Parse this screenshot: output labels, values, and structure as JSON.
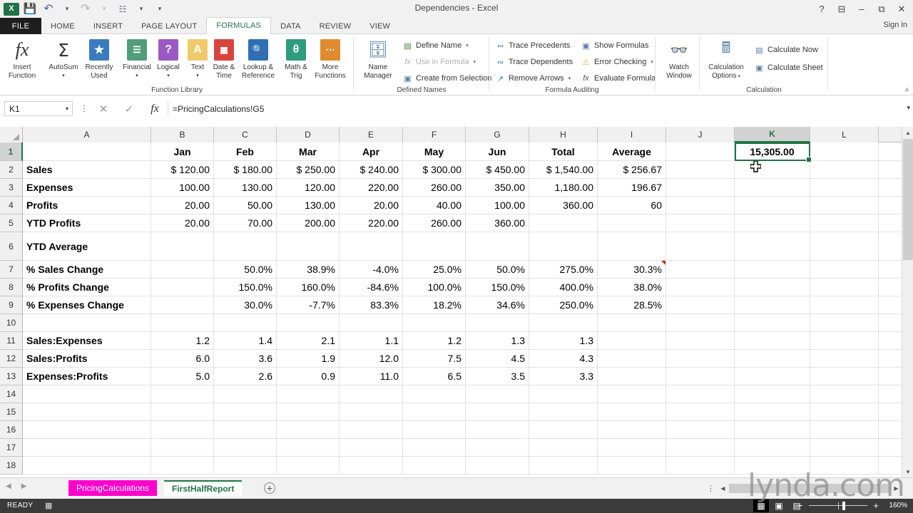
{
  "window": {
    "title": "Dependencies - Excel",
    "signin": "Sign in",
    "help_icon": "?",
    "ribbon_display_icon": "ribbon-display-options",
    "minimize_icon": "minimize",
    "restore_icon": "restore",
    "close_icon": "close"
  },
  "qat": {
    "app_icon": "excel-logo",
    "save_icon": "save",
    "undo_icon": "undo",
    "redo_icon": "redo",
    "touch_icon": "touch-mode",
    "more_icon": "customize-quick-access"
  },
  "tabs": {
    "file": "FILE",
    "items": [
      {
        "label": "HOME",
        "active": false
      },
      {
        "label": "INSERT",
        "active": false
      },
      {
        "label": "PAGE LAYOUT",
        "active": false
      },
      {
        "label": "FORMULAS",
        "active": true
      },
      {
        "label": "DATA",
        "active": false
      },
      {
        "label": "REVIEW",
        "active": false
      },
      {
        "label": "VIEW",
        "active": false
      }
    ]
  },
  "ribbon": {
    "collapse_icon": "collapse-ribbon",
    "groups": [
      {
        "label": "Function Library"
      },
      {
        "label": "Defined Names"
      },
      {
        "label": "Formula Auditing"
      },
      {
        "label": "Calculation"
      }
    ],
    "function_library": {
      "insert_function": "Insert\nFunction",
      "insert_function_l1": "Insert",
      "insert_function_l2": "Function",
      "autosum_l1": "AutoSum",
      "recently_used_l1": "Recently",
      "recently_used_l2": "Used",
      "financial_l1": "Financial",
      "logical_l1": "Logical",
      "text_l1": "Text",
      "datetime_l1": "Date &",
      "datetime_l2": "Time",
      "lookup_l1": "Lookup &",
      "lookup_l2": "Reference",
      "math_l1": "Math &",
      "math_l2": "Trig",
      "more_l1": "More",
      "more_l2": "Functions"
    },
    "defined_names": {
      "name_manager_l1": "Name",
      "name_manager_l2": "Manager",
      "define_name": "Define Name",
      "use_in_formula": "Use in Formula",
      "create_from_selection": "Create from Selection"
    },
    "formula_auditing": {
      "trace_precedents": "Trace Precedents",
      "trace_dependents": "Trace Dependents",
      "remove_arrows": "Remove Arrows",
      "show_formulas": "Show Formulas",
      "error_checking": "Error Checking",
      "evaluate_formula": "Evaluate Formula",
      "watch_window_l1": "Watch",
      "watch_window_l2": "Window"
    },
    "calculation": {
      "calculation_options_l1": "Calculation",
      "calculation_options_l2": "Options",
      "calculate_now": "Calculate Now",
      "calculate_sheet": "Calculate Sheet"
    }
  },
  "formula_bar": {
    "name_box_value": "K1",
    "cancel_icon": "cancel",
    "enter_icon": "enter",
    "function_icon": "fx",
    "formula_value": "=PricingCalculations!G5",
    "expand_icon": "expand-formula-bar"
  },
  "grid": {
    "columns": [
      "A",
      "B",
      "C",
      "D",
      "E",
      "F",
      "G",
      "H",
      "I",
      "J",
      "K",
      "L"
    ],
    "selected_column": "K",
    "selected_row": "1",
    "selected_cell": "K1",
    "selected_cell_value": "15,305.00",
    "row_numbers": [
      "1",
      "2",
      "3",
      "4",
      "5",
      "6",
      "7",
      "8",
      "9",
      "10",
      "11",
      "12",
      "13",
      "14",
      "15",
      "16",
      "17",
      "18"
    ],
    "rows": [
      {
        "n": "1",
        "cells": [
          "",
          "Jan",
          "Feb",
          "Mar",
          "Apr",
          "May",
          "Jun",
          "Total",
          "Average",
          "",
          "15,305.00",
          ""
        ],
        "align": "c",
        "bold": true
      },
      {
        "n": "2",
        "cells": [
          "Sales",
          "$ 120.00",
          "$ 180.00",
          "$ 250.00",
          "$ 240.00",
          "$ 300.00",
          "$ 450.00",
          "$ 1,540.00",
          "$ 256.67",
          "",
          "",
          ""
        ],
        "align": "r",
        "bold": false
      },
      {
        "n": "3",
        "cells": [
          "Expenses",
          "100.00",
          "130.00",
          "120.00",
          "220.00",
          "260.00",
          "350.00",
          "1,180.00",
          "196.67",
          "",
          "",
          ""
        ],
        "align": "r",
        "bold": false
      },
      {
        "n": "4",
        "cells": [
          "Profits",
          "20.00",
          "50.00",
          "130.00",
          "20.00",
          "40.00",
          "100.00",
          "360.00",
          "60",
          "",
          "",
          ""
        ],
        "align": "r",
        "bold": false
      },
      {
        "n": "5",
        "cells": [
          "YTD Profits",
          "20.00",
          "70.00",
          "200.00",
          "220.00",
          "260.00",
          "360.00",
          "",
          "",
          "",
          "",
          ""
        ],
        "align": "r",
        "bold": false
      },
      {
        "n": "6",
        "cells": [
          "YTD Average",
          "",
          "",
          "",
          "",
          "",
          "",
          "",
          "",
          "",
          "",
          ""
        ],
        "align": "r",
        "bold": false
      },
      {
        "n": "7",
        "cells": [
          "% Sales Change",
          "",
          "50.0%",
          "38.9%",
          "-4.0%",
          "25.0%",
          "50.0%",
          "275.0%",
          "30.3%",
          "",
          "",
          ""
        ],
        "align": "r",
        "bold": false
      },
      {
        "n": "8",
        "cells": [
          "% Profits Change",
          "",
          "150.0%",
          "160.0%",
          "-84.6%",
          "100.0%",
          "150.0%",
          "400.0%",
          "38.0%",
          "",
          "",
          ""
        ],
        "align": "r",
        "bold": false
      },
      {
        "n": "9",
        "cells": [
          "% Expenses Change",
          "",
          "30.0%",
          "-7.7%",
          "83.3%",
          "18.2%",
          "34.6%",
          "250.0%",
          "28.5%",
          "",
          "",
          ""
        ],
        "align": "r",
        "bold": false
      },
      {
        "n": "10",
        "cells": [
          "",
          "",
          "",
          "",
          "",
          "",
          "",
          "",
          "",
          "",
          "",
          ""
        ],
        "align": "r",
        "bold": false
      },
      {
        "n": "11",
        "cells": [
          "Sales:Expenses",
          "1.2",
          "1.4",
          "2.1",
          "1.1",
          "1.2",
          "1.3",
          "1.3",
          "",
          "",
          "",
          ""
        ],
        "align": "r",
        "bold": false
      },
      {
        "n": "12",
        "cells": [
          "Sales:Profits",
          "6.0",
          "3.6",
          "1.9",
          "12.0",
          "7.5",
          "4.5",
          "4.3",
          "",
          "",
          "",
          ""
        ],
        "align": "r",
        "bold": false
      },
      {
        "n": "13",
        "cells": [
          "Expenses:Profits",
          "5.0",
          "2.6",
          "0.9",
          "11.0",
          "6.5",
          "3.5",
          "3.3",
          "",
          "",
          "",
          ""
        ],
        "align": "r",
        "bold": false
      },
      {
        "n": "14",
        "cells": [
          "",
          "",
          "",
          "",
          "",
          "",
          "",
          "",
          "",
          "",
          "",
          ""
        ],
        "align": "r",
        "bold": false
      },
      {
        "n": "15",
        "cells": [
          "",
          "",
          "",
          "",
          "",
          "",
          "",
          "",
          "",
          "",
          "",
          ""
        ],
        "align": "r",
        "bold": false
      },
      {
        "n": "16",
        "cells": [
          "",
          "",
          "",
          "",
          "",
          "",
          "",
          "",
          "",
          "",
          "",
          ""
        ],
        "align": "r",
        "bold": false
      },
      {
        "n": "17",
        "cells": [
          "",
          "",
          "",
          "",
          "",
          "",
          "",
          "",
          "",
          "",
          "",
          ""
        ],
        "align": "r",
        "bold": false
      },
      {
        "n": "18",
        "cells": [
          "",
          "",
          "",
          "",
          "",
          "",
          "",
          "",
          "",
          "",
          "",
          ""
        ],
        "align": "r",
        "bold": false
      }
    ],
    "comment_cell": "I7"
  },
  "sheets": {
    "prev_icon": "previous-sheet",
    "next_icon": "next-sheet",
    "tabs": [
      {
        "label": "PricingCalculations",
        "active": false,
        "color": "#ff00cc"
      },
      {
        "label": "FirstHalfReport",
        "active": true,
        "color": "#ffffff"
      }
    ],
    "add_icon": "add-sheet"
  },
  "status": {
    "mode": "READY",
    "macro_icon": "record-macro",
    "view_normal_icon": "normal-view",
    "view_layout_icon": "page-layout-view",
    "view_pagebreak_icon": "page-break-preview",
    "zoom_out_icon": "zoom-out",
    "zoom_in_icon": "zoom-in",
    "zoom_level": "160%"
  },
  "watermark": {
    "text": "lynda.com"
  },
  "colors": {
    "excel_green": "#217346",
    "sheet_tab_pink": "#ff00cc",
    "comment_red": "#d02020",
    "status_bg": "#3b3b3b"
  }
}
